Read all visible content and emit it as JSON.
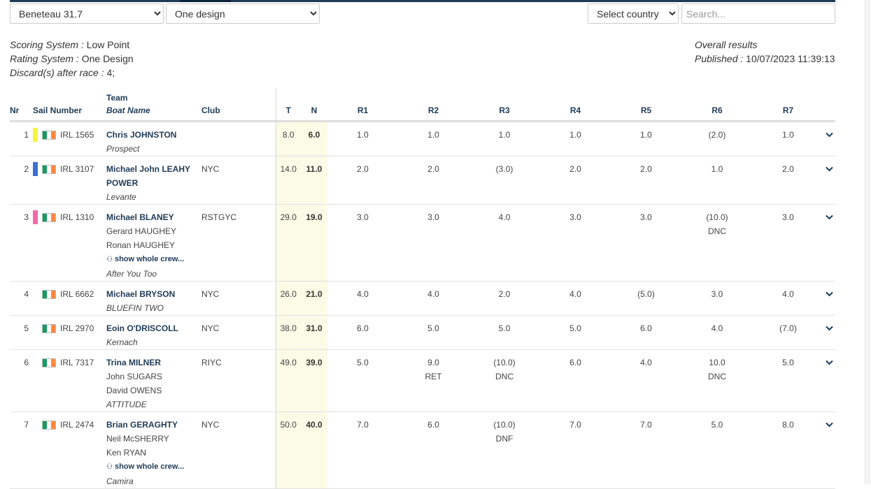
{
  "filters": {
    "class_selected": "Beneteau 31.7",
    "division_selected": "One design",
    "country_selected": "Select country",
    "search_placeholder": "Search..."
  },
  "info": {
    "scoring_label": "Scoring System :",
    "scoring_value": "Low Point",
    "rating_label": "Rating System :",
    "rating_value": "One Design",
    "discard_label": "Discard(s) after race :",
    "discard_value": "4;",
    "overall": "Overall results",
    "published_label": "Published :",
    "published_value": "10/07/2023 11:39:13"
  },
  "columns": {
    "nr": "Nr",
    "sail": "Sail Number",
    "team": "Team",
    "boat": "Boat Name",
    "club": "Club",
    "t": "T",
    "n": "N",
    "races": [
      "R1",
      "R2",
      "R3",
      "R4",
      "R5",
      "R6",
      "R7"
    ]
  },
  "show_crew_label": "show whole crew...",
  "colors": {
    "accent": "#1f3b57",
    "highlight": "#fbfbe6",
    "flag_green": "#169b62",
    "flag_white": "#ffffff",
    "flag_orange": "#ff883e"
  },
  "rows": [
    {
      "nr": "1",
      "color": "#f5f542",
      "sail": "IRL 1565",
      "skipper": "Chris JOHNSTON",
      "crew": [],
      "show_crew": false,
      "boat": "Prospect",
      "club": "",
      "t": "8.0",
      "n": "6.0",
      "races": [
        [
          "1.0",
          ""
        ],
        [
          "1.0",
          ""
        ],
        [
          "1.0",
          ""
        ],
        [
          "1.0",
          ""
        ],
        [
          "1.0",
          ""
        ],
        [
          "(2.0)",
          ""
        ],
        [
          "1.0",
          ""
        ]
      ]
    },
    {
      "nr": "2",
      "color": "#3b6fd4",
      "sail": "IRL 3107",
      "skipper": "Michael John LEAHY POWER",
      "crew": [],
      "show_crew": false,
      "boat": "Levante",
      "club": "NYC",
      "t": "14.0",
      "n": "11.0",
      "races": [
        [
          "2.0",
          ""
        ],
        [
          "2.0",
          ""
        ],
        [
          "(3.0)",
          ""
        ],
        [
          "2.0",
          ""
        ],
        [
          "2.0",
          ""
        ],
        [
          "1.0",
          ""
        ],
        [
          "2.0",
          ""
        ]
      ]
    },
    {
      "nr": "3",
      "color": "#f06aa8",
      "sail": "IRL 1310",
      "skipper": "Michael BLANEY",
      "crew": [
        "Gerard HAUGHEY",
        "Ronan HAUGHEY"
      ],
      "show_crew": true,
      "boat": "After You Too",
      "club": "RSTGYC",
      "t": "29.0",
      "n": "19.0",
      "races": [
        [
          "3.0",
          ""
        ],
        [
          "3.0",
          ""
        ],
        [
          "4.0",
          ""
        ],
        [
          "3.0",
          ""
        ],
        [
          "3.0",
          ""
        ],
        [
          "(10.0)",
          "DNC"
        ],
        [
          "3.0",
          ""
        ]
      ]
    },
    {
      "nr": "4",
      "color": "",
      "sail": "IRL 6662",
      "skipper": "Michael BRYSON",
      "crew": [],
      "show_crew": false,
      "boat": "BLUEFIN TWO",
      "club": "NYC",
      "t": "26.0",
      "n": "21.0",
      "races": [
        [
          "4.0",
          ""
        ],
        [
          "4.0",
          ""
        ],
        [
          "2.0",
          ""
        ],
        [
          "4.0",
          ""
        ],
        [
          "(5.0)",
          ""
        ],
        [
          "3.0",
          ""
        ],
        [
          "4.0",
          ""
        ]
      ]
    },
    {
      "nr": "5",
      "color": "",
      "sail": "IRL 2970",
      "skipper": "Eoin O'DRISCOLL",
      "crew": [],
      "show_crew": false,
      "boat": "Kernach",
      "club": "NYC",
      "t": "38.0",
      "n": "31.0",
      "races": [
        [
          "6.0",
          ""
        ],
        [
          "5.0",
          ""
        ],
        [
          "5.0",
          ""
        ],
        [
          "5.0",
          ""
        ],
        [
          "6.0",
          ""
        ],
        [
          "4.0",
          ""
        ],
        [
          "(7.0)",
          ""
        ]
      ]
    },
    {
      "nr": "6",
      "color": "",
      "sail": "IRL 7317",
      "skipper": "Trina MILNER",
      "crew": [
        "John SUGARS",
        "David OWENS"
      ],
      "show_crew": false,
      "boat": "ATTITUDE",
      "club": "RIYC",
      "t": "49.0",
      "n": "39.0",
      "races": [
        [
          "5.0",
          ""
        ],
        [
          "9.0",
          "RET"
        ],
        [
          "(10.0)",
          "DNC"
        ],
        [
          "6.0",
          ""
        ],
        [
          "4.0",
          ""
        ],
        [
          "10.0",
          "DNC"
        ],
        [
          "5.0",
          ""
        ]
      ]
    },
    {
      "nr": "7",
      "color": "",
      "sail": "IRL 2474",
      "skipper": "Brian GERAGHTY",
      "crew": [
        "Neil McSHERRY",
        "Ken RYAN"
      ],
      "show_crew": true,
      "boat": "Camira",
      "club": "NYC",
      "t": "50.0",
      "n": "40.0",
      "races": [
        [
          "7.0",
          ""
        ],
        [
          "6.0",
          ""
        ],
        [
          "(10.0)",
          "DNF"
        ],
        [
          "7.0",
          ""
        ],
        [
          "7.0",
          ""
        ],
        [
          "5.0",
          ""
        ],
        [
          "8.0",
          ""
        ]
      ]
    }
  ]
}
